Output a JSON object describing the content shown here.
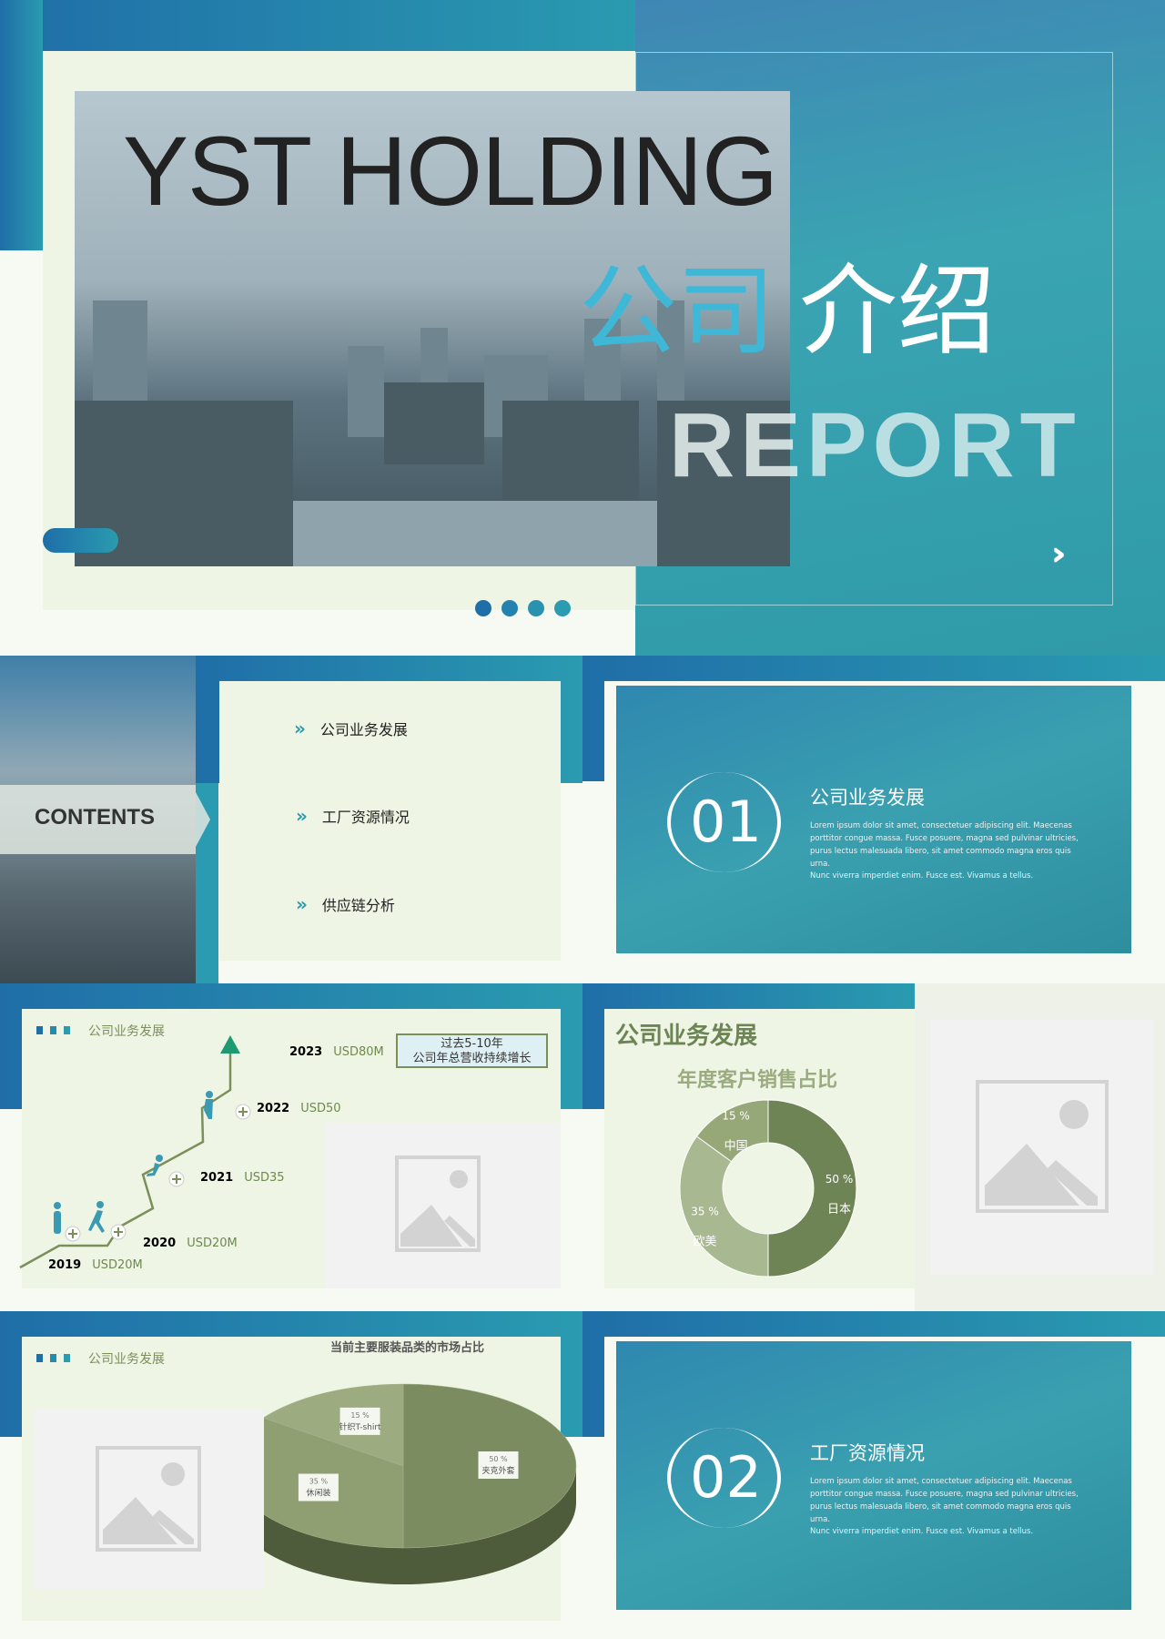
{
  "slide1": {
    "title": "YST HOLDING",
    "cn_title_a": "公司",
    "cn_title_b": "介绍",
    "report_a": "RE",
    "report_b": "PORT",
    "arrows_icon": "triple-chevron-right",
    "dots": 4
  },
  "slide2": {
    "contents_label": "CONTENTS",
    "menu": [
      {
        "label": "公司业务发展"
      },
      {
        "label": "工厂资源情况"
      },
      {
        "label": "供应链分析"
      }
    ],
    "section": {
      "number": "01",
      "title": "公司业务发展",
      "body1": "Lorem ipsum dolor sit amet, consectetuer adipiscing elit. Maecenas porttitor congue massa. Fusce posuere, magna sed pulvinar ultricies, purus lectus malesuada libero, sit amet commodo magna eros quis urna.",
      "body2": "Nunc viverra imperdiet enim. Fusce est. Vivamus a tellus."
    }
  },
  "slide3": {
    "header": "公司业务发展",
    "callout_line1": "过去5-10年",
    "callout_line2": "公司年总营收持续增长",
    "timeline": [
      {
        "year": "2019",
        "value": "USD20M"
      },
      {
        "year": "2020",
        "value": "USD20M"
      },
      {
        "year": "2021",
        "value": "USD35"
      },
      {
        "year": "2022",
        "value": "USD50"
      },
      {
        "year": "2023",
        "value": "USD80M"
      }
    ],
    "right_title": "公司业务发展"
  },
  "slide4": {
    "header": "公司业务发展",
    "section": {
      "number": "02",
      "title": "工厂资源情况",
      "body1": "Lorem ipsum dolor sit amet, consectetuer adipiscing elit. Maecenas porttitor congue massa. Fusce posuere, magna sed pulvinar ultricies, purus lectus malesuada libero, sit amet commodo magna eros quis urna.",
      "body2": "Nunc viverra imperdiet enim. Fusce est. Vivamus a tellus."
    }
  },
  "chart_data": [
    {
      "type": "pie",
      "variant": "donut",
      "title": "年度客户销售占比",
      "categories": [
        "日本",
        "欧美",
        "中国"
      ],
      "values": [
        50,
        35,
        15
      ],
      "labels": [
        "50 %",
        "35 %",
        "15 %"
      ],
      "colors": [
        "#6e8455",
        "#a8b890",
        "#97a878"
      ]
    },
    {
      "type": "pie",
      "variant": "3d",
      "title": "当前主要服装品类的市场占比",
      "categories": [
        "夹克外套",
        "休闲装",
        "针织T-shirt"
      ],
      "values": [
        50,
        35,
        15
      ],
      "labels": [
        "50 %",
        "35 %",
        "15 %"
      ],
      "colors": [
        "#7a8c60",
        "#8f9f72",
        "#9dab80"
      ]
    }
  ]
}
